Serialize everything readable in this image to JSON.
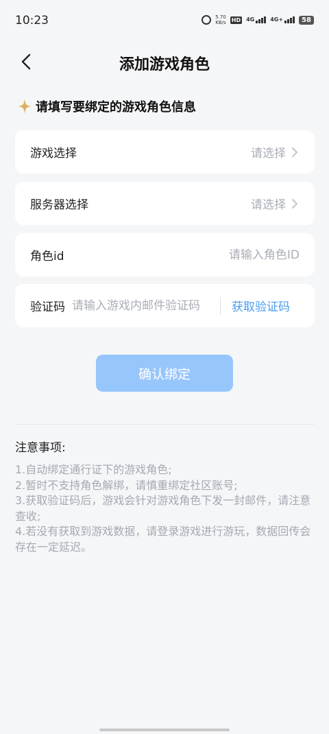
{
  "status_bar": {
    "time": "10:23",
    "speed_value": "5.70",
    "speed_unit": "KB/s",
    "hd_label": "HD",
    "net1_label": "4G",
    "net2_label": "4G+",
    "battery": "58"
  },
  "header": {
    "title": "添加游戏角色"
  },
  "subtitle": "请填写要绑定的游戏角色信息",
  "form": {
    "game": {
      "label": "游戏选择",
      "placeholder": "请选择"
    },
    "server": {
      "label": "服务器选择",
      "placeholder": "请选择"
    },
    "role_id": {
      "label": "角色id",
      "placeholder": "请输入角色ID"
    },
    "code": {
      "label": "验证码",
      "placeholder": "请输入游戏内邮件验证码",
      "get_code": "获取验证码"
    }
  },
  "confirm_button": "确认绑定",
  "notes": {
    "title": "注意事项:",
    "items": [
      "1.自动绑定通行证下的游戏角色;",
      "2.暂时不支持角色解绑，请慎重绑定社区账号;",
      "3.获取验证码后，游戏会针对游戏角色下发一封邮件，请注意查收;",
      "4.若没有获取到游戏数据，请登录游戏进行游玩，数据回传会存在一定延迟。"
    ]
  },
  "colors": {
    "accent": "#4a9cf0",
    "button_disabled": "#97c6fc",
    "sparkle": "#d9b15c",
    "background": "#f5f6f8"
  }
}
